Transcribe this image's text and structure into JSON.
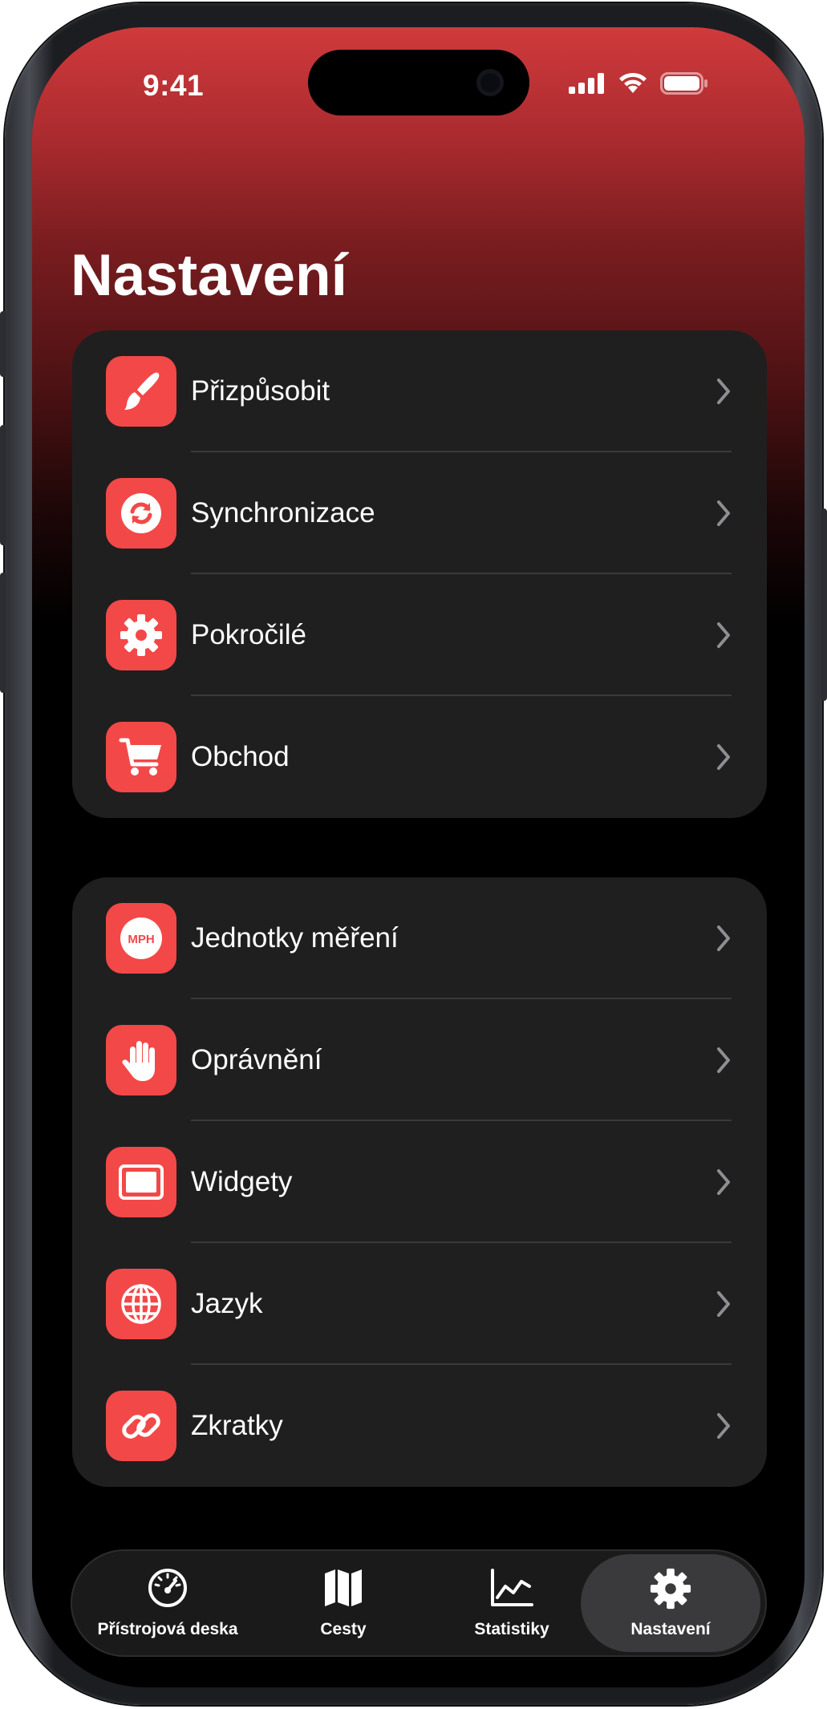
{
  "status_bar": {
    "time": "9:41"
  },
  "page": {
    "title": "Nastavení"
  },
  "group1": [
    {
      "label": "Přizpůsobit",
      "icon": "paintbrush-icon"
    },
    {
      "label": "Synchronizace",
      "icon": "sync-icon"
    },
    {
      "label": "Pokročilé",
      "icon": "gear-icon"
    },
    {
      "label": "Obchod",
      "icon": "cart-icon"
    }
  ],
  "group2": [
    {
      "label": "Jednotky měření",
      "icon": "mph-icon",
      "icon_text": "MPH"
    },
    {
      "label": "Oprávnění",
      "icon": "hand-icon"
    },
    {
      "label": "Widgety",
      "icon": "widget-icon"
    },
    {
      "label": "Jazyk",
      "icon": "globe-icon"
    },
    {
      "label": "Zkratky",
      "icon": "link-icon"
    }
  ],
  "tabs": [
    {
      "label": "Přístrojová deska",
      "icon": "speedometer-icon",
      "active": false
    },
    {
      "label": "Cesty",
      "icon": "map-icon",
      "active": false
    },
    {
      "label": "Statistiky",
      "icon": "chart-icon",
      "active": false
    },
    {
      "label": "Nastavení",
      "icon": "gear-icon",
      "active": true
    }
  ],
  "colors": {
    "accent": "#f34848",
    "card": "#1f1f20",
    "header_top": "#d03a3c"
  }
}
